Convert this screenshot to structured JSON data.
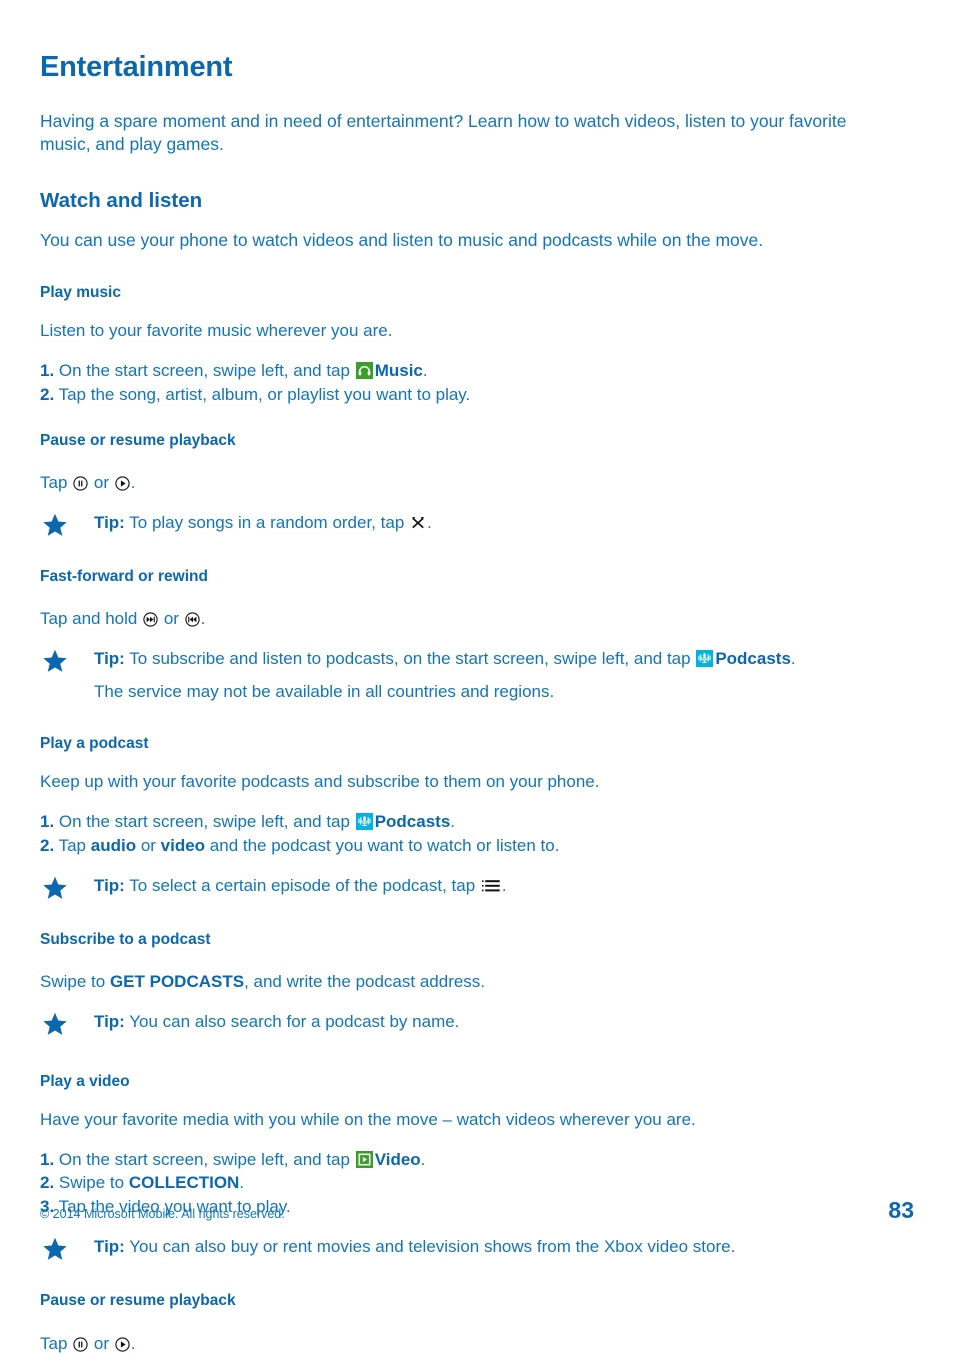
{
  "document": {
    "title": "Entertainment",
    "intro": "Having a spare moment and in need of entertainment? Learn how to watch videos, listen to your favorite music, and play games.",
    "page_number": "83",
    "copyright": "© 2014 Microsoft Mobile. All rights reserved.",
    "colors": {
      "heading_blue": "#0b67ae",
      "body_blue": "#1275ba",
      "music_tile_green": "#3c9e2a",
      "video_tile_green": "#3c9e2a",
      "podcast_tile_cyan": "#00b3e3",
      "page_background": "#ffffff"
    }
  },
  "section": {
    "heading": "Watch and listen",
    "lead": "You can use your phone to watch videos and listen to music and podcasts while on the move."
  },
  "play_music": {
    "heading": "Play music",
    "intro": "Listen to your favorite music wherever you are.",
    "step1_num": "1.",
    "step1_a": " On the start screen, swipe left, and tap ",
    "step1_app": "Music",
    "step1_b": ".",
    "step2_num": "2.",
    "step2_text": " Tap the song, artist, album, or playlist you want to play.",
    "pause_heading": "Pause or resume playback",
    "pause_text_a": "Tap ",
    "pause_text_b": " or ",
    "pause_text_c": ".",
    "tip_label": "Tip:",
    "tip_text_a": " To play songs in a random order, tap ",
    "tip_text_b": ".",
    "ff_heading": "Fast-forward or rewind",
    "ff_text_a": "Tap and hold ",
    "ff_text_b": " or ",
    "ff_text_c": ".",
    "podcast_tip_label": "Tip:",
    "podcast_tip_a": " To subscribe and listen to podcasts, on the start screen, swipe left, and tap ",
    "podcast_tip_app": "Podcasts",
    "podcast_tip_b": ".",
    "podcast_tip_line2": "The service may not be available in all countries and regions."
  },
  "play_podcast": {
    "heading": "Play a podcast",
    "intro": "Keep up with your favorite podcasts and subscribe to them on your phone.",
    "step1_num": "1.",
    "step1_a": " On the start screen, swipe left, and tap ",
    "step1_app": "Podcasts",
    "step1_b": ".",
    "step2_num": "2.",
    "step2_a": " Tap ",
    "step2_bold1": "audio",
    "step2_mid": " or ",
    "step2_bold2": "video",
    "step2_b": " and the podcast you want to watch or listen to.",
    "tip_label": "Tip:",
    "tip_text_a": " To select a certain episode of the podcast, tap ",
    "tip_text_b": ".",
    "subscribe_heading": "Subscribe to a podcast",
    "subscribe_a": "Swipe to ",
    "subscribe_bold": "GET PODCASTS",
    "subscribe_b": ", and write the podcast address.",
    "subscribe_tip_label": "Tip:",
    "subscribe_tip_text": " You can also search for a podcast by name."
  },
  "play_video": {
    "heading": "Play a video",
    "intro": "Have your favorite media with you while on the move – watch videos wherever you are.",
    "step1_num": "1.",
    "step1_a": " On the start screen, swipe left, and tap ",
    "step1_app": "Video",
    "step1_b": ".",
    "step2_num": "2.",
    "step2_a": " Swipe to ",
    "step2_bold": "COLLECTION",
    "step2_b": ".",
    "step3_num": "3.",
    "step3_text": " Tap the video you want to play.",
    "tip_label": "Tip:",
    "tip_text": " You can also buy or rent movies and television shows from the Xbox video store.",
    "pause_heading": "Pause or resume playback",
    "pause_text_a": "Tap ",
    "pause_text_b": " or ",
    "pause_text_c": "."
  },
  "icons": {
    "star": "star-icon",
    "music_tile": "music-app-tile-icon",
    "podcasts_tile": "podcasts-app-tile-icon",
    "video_tile": "video-app-tile-icon",
    "pause": "pause-circle-icon",
    "play": "play-circle-icon",
    "shuffle": "shuffle-icon",
    "fast_forward": "fast-forward-circle-icon",
    "rewind": "rewind-circle-icon",
    "episode_list": "bulleted-list-icon"
  }
}
